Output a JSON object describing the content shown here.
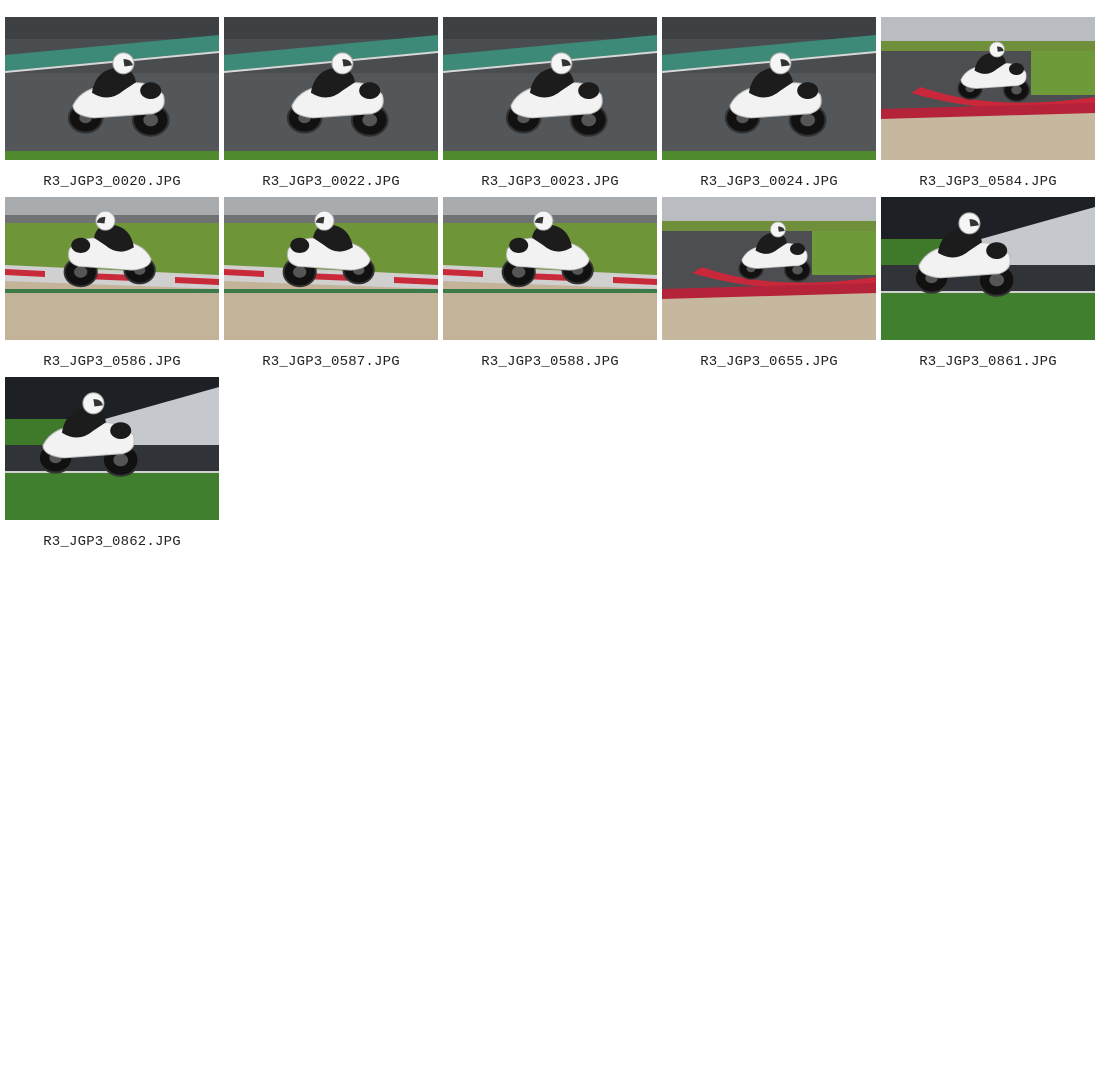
{
  "gallery": {
    "items": [
      {
        "filename": "R3_JGP3_0020.JPG",
        "scene": "wet-track",
        "heading": "right"
      },
      {
        "filename": "R3_JGP3_0022.JPG",
        "scene": "wet-track",
        "heading": "right"
      },
      {
        "filename": "R3_JGP3_0023.JPG",
        "scene": "wet-track",
        "heading": "right"
      },
      {
        "filename": "R3_JGP3_0024.JPG",
        "scene": "wet-track",
        "heading": "right"
      },
      {
        "filename": "R3_JGP3_0584.JPG",
        "scene": "kerb-corner",
        "heading": "right"
      },
      {
        "filename": "R3_JGP3_0586.JPG",
        "scene": "kerb-grass",
        "heading": "left"
      },
      {
        "filename": "R3_JGP3_0587.JPG",
        "scene": "kerb-grass",
        "heading": "left"
      },
      {
        "filename": "R3_JGP3_0588.JPG",
        "scene": "kerb-grass",
        "heading": "left"
      },
      {
        "filename": "R3_JGP3_0655.JPG",
        "scene": "kerb-corner",
        "heading": "right"
      },
      {
        "filename": "R3_JGP3_0861.JPG",
        "scene": "dark-wall",
        "heading": "right"
      },
      {
        "filename": "R3_JGP3_0862.JPG",
        "scene": "dark-wall",
        "heading": "right"
      }
    ]
  },
  "colors": {
    "page_background": "#ffffff",
    "caption_text": "#222222"
  }
}
